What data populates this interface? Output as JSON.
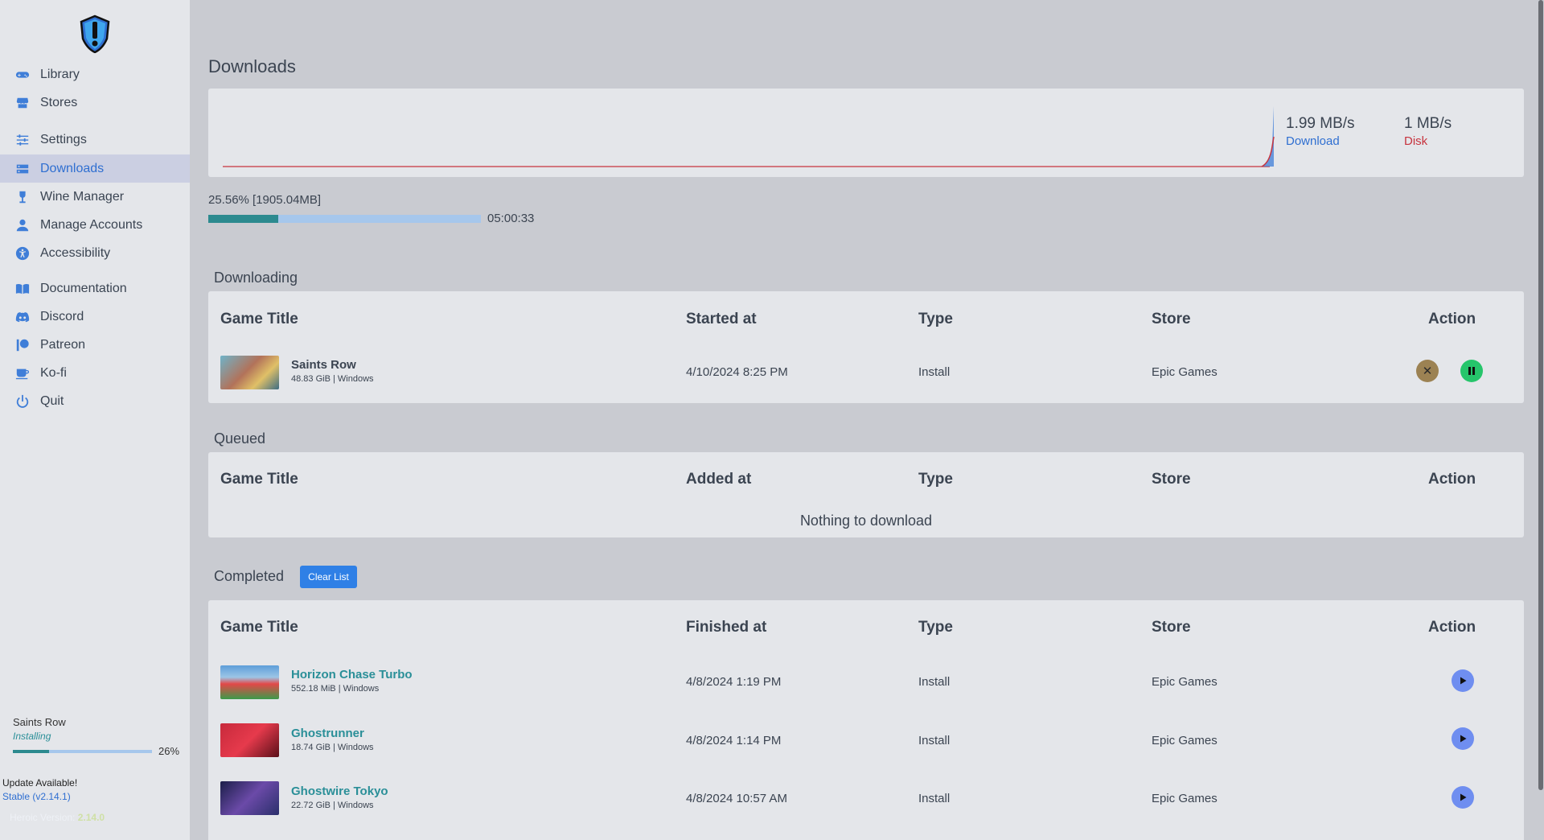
{
  "sidebar": {
    "logo": "heroic-logo",
    "items": [
      {
        "label": "Library",
        "icon": "gamepad-icon",
        "active": false
      },
      {
        "label": "Stores",
        "icon": "store-icon",
        "active": false
      },
      {
        "label": "Settings",
        "icon": "sliders-icon",
        "active": false
      },
      {
        "label": "Downloads",
        "icon": "downloads-icon",
        "active": true
      },
      {
        "label": "Wine Manager",
        "icon": "wine-icon",
        "active": false
      },
      {
        "label": "Manage Accounts",
        "icon": "user-icon",
        "active": false
      },
      {
        "label": "Accessibility",
        "icon": "accessibility-icon",
        "active": false
      },
      {
        "label": "Documentation",
        "icon": "book-icon",
        "active": false
      },
      {
        "label": "Discord",
        "icon": "discord-icon",
        "active": false
      },
      {
        "label": "Patreon",
        "icon": "patreon-icon",
        "active": false
      },
      {
        "label": "Ko-fi",
        "icon": "coffee-icon",
        "active": false
      },
      {
        "label": "Quit",
        "icon": "power-icon",
        "active": false
      }
    ],
    "current_download": {
      "title": "Saints Row",
      "status": "Installing",
      "percent_label": "26%",
      "progress": 0.26
    },
    "update_text": "Update Available!",
    "update_link": "Stable (v2.14.1)",
    "version_label": "Heroic Version:",
    "version_value": "2.14.0"
  },
  "main": {
    "title": "Downloads",
    "download_speed": "1.99 MB/s",
    "download_label": "Download",
    "disk_speed": "1 MB/s",
    "disk_label": "Disk",
    "progress_text": "25.56% [1905.04MB]",
    "progress": 0.2556,
    "eta": "05:00:33",
    "colors": {
      "download": "#2f6fd1",
      "disk": "#c7343f",
      "accent": "#2a8f98"
    }
  },
  "downloading": {
    "section_label": "Downloading",
    "headers": [
      "Game Title",
      "Started at",
      "Type",
      "Store",
      "Action"
    ],
    "rows": [
      {
        "title": "Saints Row",
        "sub": "48.83 GiB | Windows",
        "time": "4/10/2024 8:25 PM",
        "type": "Install",
        "store": "Epic Games"
      }
    ]
  },
  "queued": {
    "section_label": "Queued",
    "headers": [
      "Game Title",
      "Added at",
      "Type",
      "Store",
      "Action"
    ],
    "empty_text": "Nothing to download"
  },
  "completed": {
    "section_label": "Completed",
    "clear_label": "Clear List",
    "headers": [
      "Game Title",
      "Finished at",
      "Type",
      "Store",
      "Action"
    ],
    "rows": [
      {
        "title": "Horizon Chase Turbo",
        "sub": "552.18 MiB | Windows",
        "time": "4/8/2024 1:19 PM",
        "type": "Install",
        "store": "Epic Games"
      },
      {
        "title": "Ghostrunner",
        "sub": "18.74 GiB | Windows",
        "time": "4/8/2024 1:14 PM",
        "type": "Install",
        "store": "Epic Games"
      },
      {
        "title": "Ghostwire Tokyo",
        "sub": "22.72 GiB | Windows",
        "time": "4/8/2024 10:57 AM",
        "type": "Install",
        "store": "Epic Games"
      }
    ]
  }
}
